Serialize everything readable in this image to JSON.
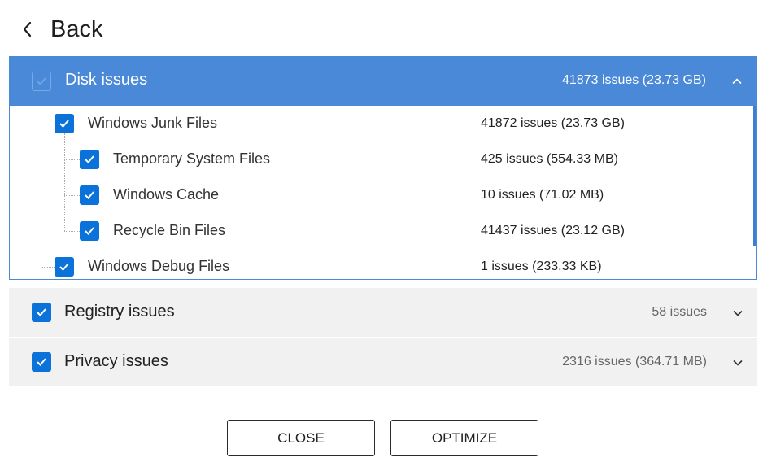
{
  "header": {
    "back_label": "Back"
  },
  "disk": {
    "title": "Disk issues",
    "count": "41873 issues (23.73 GB)",
    "expanded": true,
    "items": [
      {
        "name": "Windows Junk Files",
        "value": "41872 issues (23.73 GB)",
        "checked": true,
        "level": 1
      },
      {
        "name": "Temporary System Files",
        "value": "425 issues (554.33 MB)",
        "checked": true,
        "level": 2
      },
      {
        "name": "Windows Cache",
        "value": "10 issues (71.02 MB)",
        "checked": true,
        "level": 2
      },
      {
        "name": "Recycle Bin Files",
        "value": "41437 issues (23.12 GB)",
        "checked": true,
        "level": 2
      },
      {
        "name": "Windows Debug Files",
        "value": "1 issues (233.33 KB)",
        "checked": true,
        "level": 1
      }
    ]
  },
  "registry": {
    "title": "Registry issues",
    "count": "58 issues",
    "checked": true
  },
  "privacy": {
    "title": "Privacy issues",
    "count": "2316 issues (364.71 MB)",
    "checked": true
  },
  "buttons": {
    "close_label": "CLOSE",
    "optimize_label": "OPTIMIZE"
  },
  "colors": {
    "accent": "#4a88d8",
    "checkbox": "#0a72d8",
    "section_bg": "#f1f1f1"
  },
  "icons": {
    "back": "chevron-left-icon",
    "collapse": "chevron-up-icon",
    "expand": "chevron-down-icon",
    "check": "checkmark-icon"
  }
}
